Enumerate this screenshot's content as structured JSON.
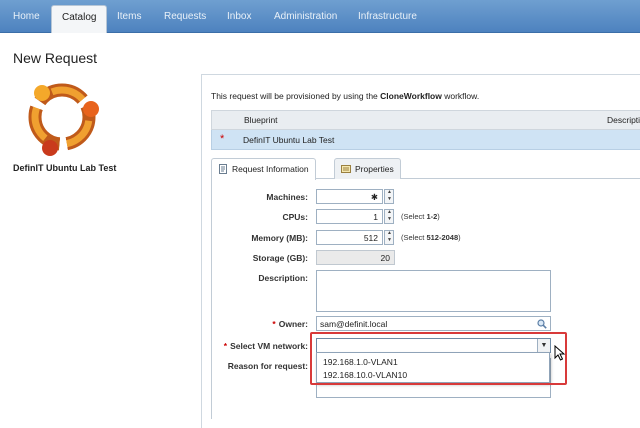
{
  "nav": {
    "tabs": [
      {
        "label": "Home"
      },
      {
        "label": "Catalog"
      },
      {
        "label": "Items"
      },
      {
        "label": "Requests"
      },
      {
        "label": "Inbox"
      },
      {
        "label": "Administration"
      },
      {
        "label": "Infrastructure"
      }
    ],
    "active_tab": "Catalog"
  },
  "page": {
    "title": "New Request"
  },
  "catalog_item": {
    "name": "DefinIT Ubuntu Lab Test",
    "logo": "ubuntu-logo"
  },
  "intro": {
    "prefix": "This request will be provisioned by using the ",
    "workflow": "CloneWorkflow",
    "suffix": " workflow."
  },
  "blueprint_table": {
    "headers": [
      "Blueprint",
      "Descripti"
    ],
    "rows": [
      {
        "marker": "*",
        "name": "DefinIT Ubuntu Lab Test"
      }
    ]
  },
  "subtabs": [
    {
      "label": "Request Information",
      "icon": "document-icon"
    },
    {
      "label": "Properties",
      "icon": "properties-icon"
    }
  ],
  "form": {
    "machines": {
      "label": "Machines:",
      "value": "✱"
    },
    "cpus": {
      "label": "CPUs:",
      "value": "1",
      "hint_prefix": "(Select ",
      "hint_value": "1-2",
      "hint_suffix": ")"
    },
    "memory": {
      "label": "Memory (MB):",
      "value": "512",
      "hint_prefix": "(Select ",
      "hint_value": "512-2048",
      "hint_suffix": ")"
    },
    "storage": {
      "label": "Storage (GB):",
      "value": "20"
    },
    "description": {
      "label": "Description:",
      "value": ""
    },
    "owner": {
      "label": "Owner:",
      "value": "sam@definit.local",
      "required": "*"
    },
    "vm_network": {
      "label": "Select VM network:",
      "value": "",
      "required": "*",
      "options": [
        "192.168.1.0-VLAN1",
        "192.168.10.0-VLAN10"
      ]
    },
    "reason": {
      "label": "Reason for request:",
      "value": ""
    }
  },
  "colors": {
    "nav": "#4d82bf",
    "selected_row": "#cfe3f4",
    "required": "#cc0000",
    "highlight": "#d83a3a"
  }
}
